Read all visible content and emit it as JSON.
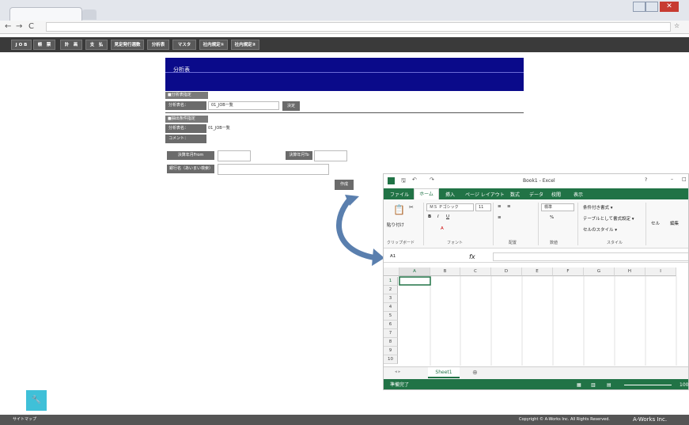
{
  "menu": [
    "J O B",
    "帳　票",
    "計　画",
    "支　払",
    "見定発行週数",
    "分析表",
    "マスタ",
    "社内規定①",
    "社内規定②"
  ],
  "page": {
    "title": "分析表",
    "sec1": "■分析表指定",
    "lbl_name": "分析表名：",
    "name_value": "01_JOB一覧",
    "decide": "決定",
    "sec2": "■抽出条件指定",
    "lbl_name2": "分析表名：",
    "name2_value": "01_JOB一覧",
    "lbl_comment": "コメント：",
    "lbl_from": "決算年月From",
    "lbl_to": "決算年月To",
    "lbl_shagyo": "銀行名（あいまい検索）",
    "create": "作成"
  },
  "footer": {
    "left": "サイトマップ",
    "copyright": "Copyright © A-Works Inc. All Rights Reserved.",
    "brand": "A-Works Inc."
  },
  "excel": {
    "title": "Book1 - Excel",
    "tabs": [
      "ファイル",
      "ホーム",
      "挿入",
      "ページ レイアウト",
      "数式",
      "データ",
      "校閲",
      "表示"
    ],
    "font_name": "ＭＳ Ｐゴシック",
    "font_size": "11",
    "number_format": "標準",
    "paste": "貼り付け",
    "cond_format": "条件付き書式 ▾",
    "as_table": "テーブルとして書式設定 ▾",
    "cell_style": "セルのスタイル ▾",
    "cell_btn": "セル",
    "edit_btn": "編集",
    "group_clip": "クリップボード",
    "group_font": "フォント",
    "group_align": "配置",
    "group_num": "数値",
    "group_style": "スタイル",
    "namebox": "A1",
    "fx": "fx",
    "columns": [
      "A",
      "B",
      "C",
      "D",
      "E",
      "F",
      "G",
      "H",
      "I"
    ],
    "rows": [
      "1",
      "2",
      "3",
      "4",
      "5",
      "6",
      "7",
      "8",
      "9",
      "10"
    ],
    "sheet": "Sheet1",
    "status": "準備完了",
    "zoom": "100"
  }
}
